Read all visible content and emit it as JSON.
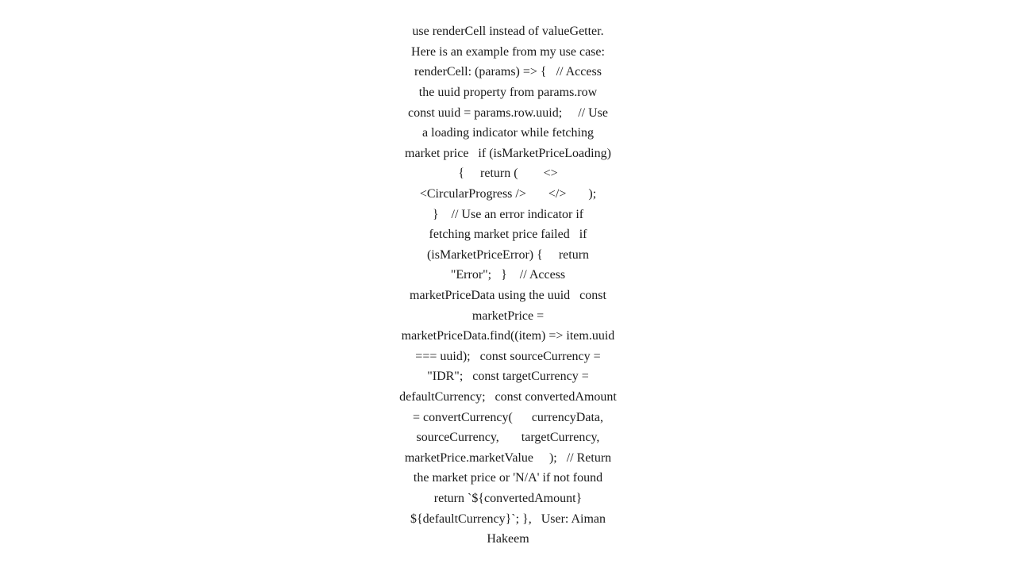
{
  "content": {
    "lines": [
      "use renderCell instead of valueGetter.",
      "Here is an example from my use case:",
      "renderCell: (params) => {   // Access",
      "the uuid property from params.row",
      "const uuid = params.row.uuid;    // Use",
      "a loading indicator while fetching",
      "market price   if (isMarketPriceLoading)",
      "{     return (        <>",
      "<CircularProgress />       </>      );",
      "}    // Use an error indicator if",
      "fetching market price failed   if",
      "(isMarketPriceError) {     return",
      "\"Error\";   }    // Access",
      "marketPriceData using the uuid   const",
      "marketPrice =",
      "marketPriceData.find((item) => item.uuid",
      "=== uuid);   const sourceCurrency =",
      "\"IDR\";   const targetCurrency =",
      "defaultCurrency;   const convertedAmount",
      "= convertCurrency(      currencyData,",
      "sourceCurrency,      targetCurrency,",
      "marketPrice.marketValue    );   // Return",
      "the market price or 'N/A' if not found",
      "return `${convertedAmount}",
      "${defaultCurrency}`; },   User: Aiman",
      "Hakeem"
    ]
  }
}
